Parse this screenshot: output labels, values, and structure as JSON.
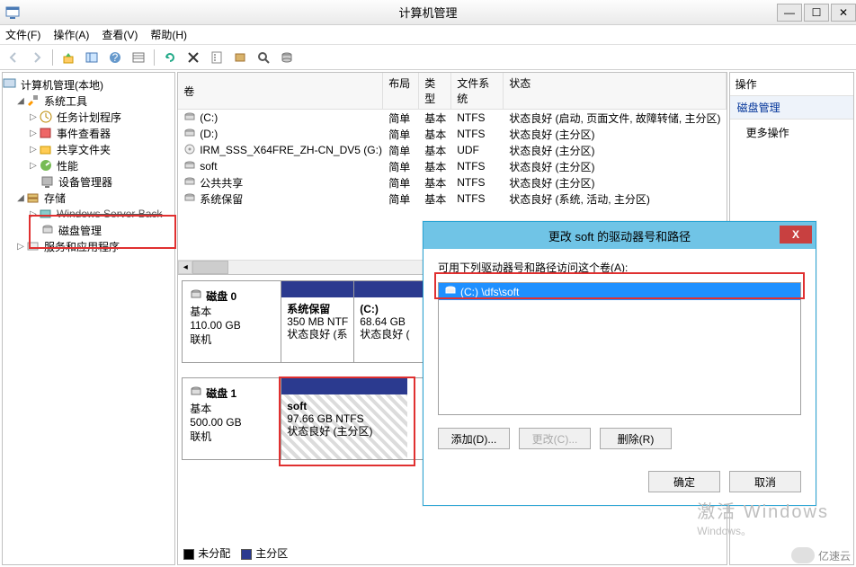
{
  "titlebar": {
    "title": "计算机管理"
  },
  "menu": {
    "file": "文件(F)",
    "action": "操作(A)",
    "view": "查看(V)",
    "help": "帮助(H)"
  },
  "tree": {
    "root": "计算机管理(本地)",
    "sys_tools": "系统工具",
    "task_sched": "任务计划程序",
    "event_viewer": "事件查看器",
    "shared_folders": "共享文件夹",
    "performance": "性能",
    "device_mgr": "设备管理器",
    "storage": "存储",
    "wsb": "Windows Server Back",
    "disk_mgmt": "磁盘管理",
    "services": "服务和应用程序"
  },
  "volumes": {
    "headers": {
      "volume": "卷",
      "layout": "布局",
      "type": "类型",
      "fs": "文件系统",
      "status": "状态"
    },
    "rows": [
      {
        "name": "(C:)",
        "layout": "简单",
        "type": "基本",
        "fs": "NTFS",
        "status": "状态良好 (启动, 页面文件, 故障转储, 主分区)"
      },
      {
        "name": "(D:)",
        "layout": "简单",
        "type": "基本",
        "fs": "NTFS",
        "status": "状态良好 (主分区)"
      },
      {
        "name": "IRM_SSS_X64FRE_ZH-CN_DV5 (G:)",
        "layout": "简单",
        "type": "基本",
        "fs": "UDF",
        "status": "状态良好 (主分区)"
      },
      {
        "name": "soft",
        "layout": "简单",
        "type": "基本",
        "fs": "NTFS",
        "status": "状态良好 (主分区)"
      },
      {
        "name": "公共共享",
        "layout": "简单",
        "type": "基本",
        "fs": "NTFS",
        "status": "状态良好 (主分区)"
      },
      {
        "name": "系统保留",
        "layout": "简单",
        "type": "基本",
        "fs": "NTFS",
        "status": "状态良好 (系统, 活动, 主分区)"
      }
    ]
  },
  "disks": [
    {
      "label": "磁盘 0",
      "mode": "基本",
      "size": "110.00 GB",
      "state": "联机",
      "parts": [
        {
          "name": "系统保留",
          "size": "350 MB NTF",
          "status": "状态良好 (系",
          "hatched": false
        },
        {
          "name": "(C:)",
          "size": "68.64 GB",
          "status": "状态良好 (",
          "hatched": false
        }
      ]
    },
    {
      "label": "磁盘 1",
      "mode": "基本",
      "size": "500.00 GB",
      "state": "联机",
      "parts": [
        {
          "name": "soft",
          "size": "97.66 GB NTFS",
          "status": "状态良好 (主分区)",
          "hatched": true
        }
      ]
    }
  ],
  "legend": {
    "unalloc": "未分配",
    "primary": "主分区"
  },
  "right": {
    "header": "操作",
    "section": "磁盘管理",
    "more": "更多操作"
  },
  "dialog": {
    "title": "更改 soft 的驱动器号和路径",
    "prompt": "可用下列驱动器号和路径访问这个卷(A):",
    "item": "(C:) \\dfs\\soft",
    "add": "添加(D)...",
    "change": "更改(C)...",
    "remove": "删除(R)",
    "ok": "确定",
    "cancel": "取消"
  },
  "watermark": {
    "line1": "激活 Windows",
    "line2": "Windows。"
  },
  "brand": "亿速云"
}
